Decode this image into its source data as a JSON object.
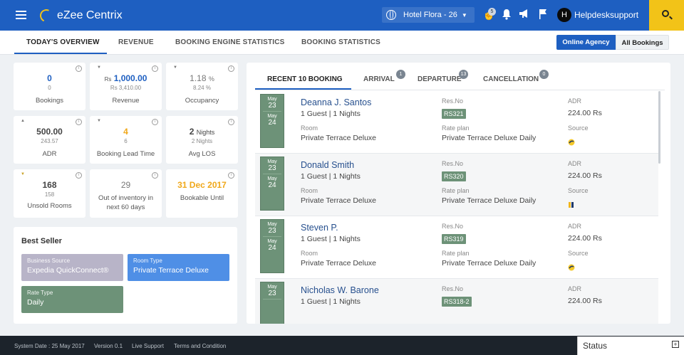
{
  "app": {
    "name": "eZee Centrix"
  },
  "header": {
    "hotel": "Hotel Flora - 26",
    "notif_count": "5",
    "user": "Helpdesksupport",
    "avatar": "H"
  },
  "main_tabs": [
    {
      "label": "TODAY'S OVERVIEW",
      "active": true
    },
    {
      "label": "REVENUE"
    },
    {
      "label": "BOOKING ENGINE STATISTICS"
    },
    {
      "label": "BOOKING STATISTICS"
    }
  ],
  "view_buttons": {
    "online": "Online Agency",
    "all": "All Bookings"
  },
  "stats": [
    {
      "value": "0",
      "sub": "0",
      "label": "Bookings"
    },
    {
      "currency": "Rs",
      "value": "1,000.00",
      "sub": "Rs 3,410.00",
      "label": "Revenue"
    },
    {
      "value": "1.18",
      "unit": "%",
      "sub": "8.24 %",
      "label": "Occupancy"
    },
    {
      "value": "500.00",
      "sub": "243.57",
      "label": "ADR"
    },
    {
      "value": "4",
      "sub": "6",
      "label": "Booking Lead Time"
    },
    {
      "value": "2",
      "unit": "Nights",
      "sub": "2 Nights",
      "label": "Avg LOS"
    },
    {
      "value": "168",
      "sub": "158",
      "label": "Unsold Rooms"
    },
    {
      "value": "29",
      "label": "Out of inventory in next 60 days"
    },
    {
      "value": "31 Dec 2017",
      "label": "Bookable Until"
    }
  ],
  "best_seller": {
    "title": "Best Seller",
    "business_source": {
      "key": "Business Source",
      "value": "Expedia QuickConnect®",
      "color": "#b8b4c8"
    },
    "room_type": {
      "key": "Room Type",
      "value": "Private Terrace Deluxe",
      "color": "#4f8fe6"
    },
    "rate_type": {
      "key": "Rate Type",
      "value": "Daily",
      "color": "#6d9278"
    }
  },
  "panel_tabs": [
    {
      "label": "RECENT 10 BOOKING",
      "active": true
    },
    {
      "label": "ARRIVAL",
      "badge": "1"
    },
    {
      "label": "DEPARTURE",
      "badge": "13"
    },
    {
      "label": "CANCELLATION",
      "badge": "0"
    }
  ],
  "booking_labels": {
    "resno": "Res.No",
    "adr": "ADR",
    "room": "Room",
    "rate_plan": "Rate plan",
    "source": "Source"
  },
  "bookings": [
    {
      "month1": "May",
      "day1": "23",
      "month2": "May",
      "day2": "24",
      "name": "Deanna J. Santos",
      "guests": "1 Guest | 1 Nights",
      "resno": "RS321",
      "adr": "224.00 Rs",
      "room": "Private Terrace Deluxe",
      "rate_plan": "Private Terrace Deluxe Daily",
      "source_icon": "expedia-icon"
    },
    {
      "month1": "May",
      "day1": "23",
      "month2": "May",
      "day2": "24",
      "name": "Donald Smith",
      "guests": "1 Guest | 1 Nights",
      "resno": "RS320",
      "adr": "224.00 Rs",
      "room": "Private Terrace Deluxe",
      "rate_plan": "Private Terrace Deluxe Daily",
      "source_icon": "booking-icon"
    },
    {
      "month1": "May",
      "day1": "23",
      "month2": "May",
      "day2": "24",
      "name": "Steven P.",
      "guests": "1 Guest | 1 Nights",
      "resno": "RS319",
      "adr": "224.00 Rs",
      "room": "Private Terrace Deluxe",
      "rate_plan": "Private Terrace Deluxe Daily",
      "source_icon": "expedia-icon"
    },
    {
      "month1": "May",
      "day1": "23",
      "name": "Nicholas W. Barone",
      "guests": "1 Guest | 1 Nights",
      "resno": "RS318-2",
      "adr": "224.00 Rs"
    }
  ],
  "footer": {
    "system_date": "System Date : 25 May 2017",
    "version": "Version 0.1",
    "live_support": "Live Support",
    "terms": "Terms and Condition",
    "status": "Status"
  }
}
